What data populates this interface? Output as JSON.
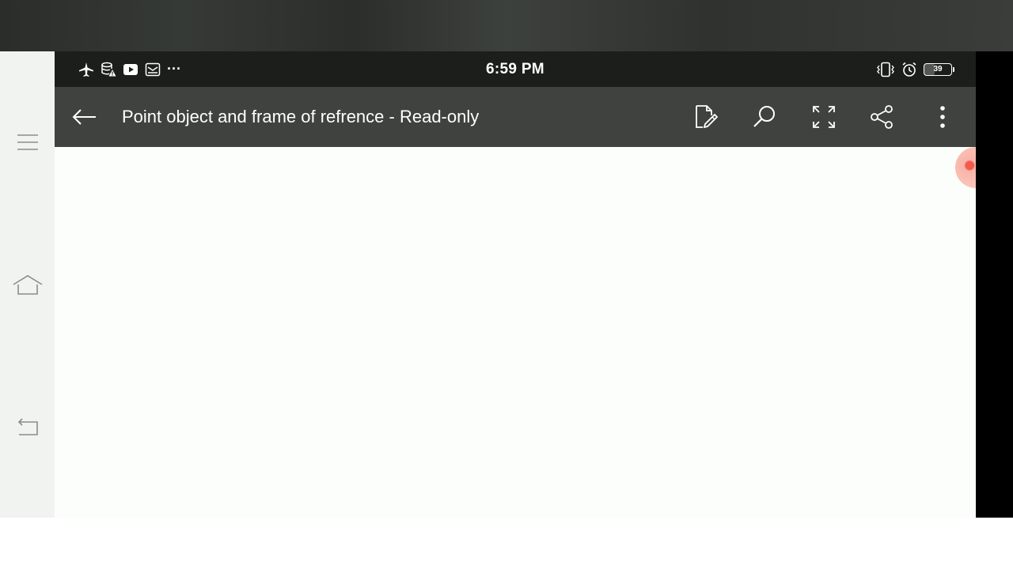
{
  "status_bar": {
    "time": "6:59 PM",
    "more_indicator": "···",
    "battery_level": "39",
    "left_icons": [
      "airplane-icon",
      "data-warning-icon",
      "youtube-icon",
      "mail-icon"
    ],
    "right_icons": [
      "vibrate-icon",
      "alarm-icon",
      "battery-icon"
    ]
  },
  "app_bar": {
    "title": "Point object and frame of refrence - Read-only",
    "actions": [
      "edit-icon",
      "search-icon",
      "fullscreen-icon",
      "share-icon",
      "more-vertical-icon"
    ]
  },
  "navigation": {
    "buttons": [
      "menu-icon",
      "home-icon",
      "back-nav-icon"
    ]
  },
  "colors": {
    "status_bar_bg": "#1c1e1c",
    "app_bar_bg": "#3f423f",
    "content_bg": "#fbfefb",
    "nav_bar_bg": "#f1f3f1",
    "floating_button": "#f25a4a"
  }
}
